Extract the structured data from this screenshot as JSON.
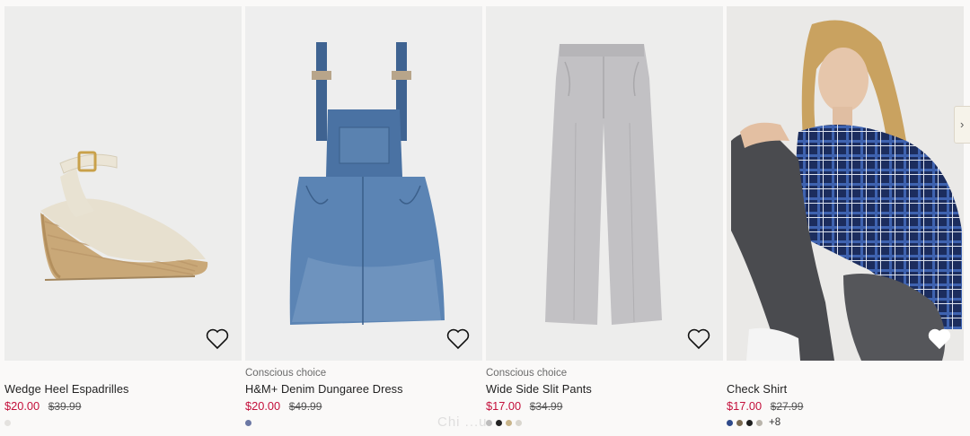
{
  "products": [
    {
      "label": "",
      "title": "Wedge Heel Espadrilles",
      "sale_price": "$20.00",
      "old_price": "$39.99",
      "swatches": [
        "#e4e2df"
      ],
      "more": ""
    },
    {
      "label": "Conscious choice",
      "title": "H&M+ Denim Dungaree Dress",
      "sale_price": "$20.00",
      "old_price": "$49.99",
      "swatches": [
        "#6b78a4"
      ],
      "more": ""
    },
    {
      "label": "Conscious choice",
      "title": "Wide Side Slit Pants",
      "sale_price": "$17.00",
      "old_price": "$34.99",
      "swatches": [
        "#bdbcbc",
        "#222222",
        "#c8b48a",
        "#d9d6cf"
      ],
      "more": ""
    },
    {
      "label": "",
      "title": "Check Shirt",
      "sale_price": "$17.00",
      "old_price": "$27.99",
      "swatches": [
        "#2f4a8a",
        "#7a6a52",
        "#1e1e1e",
        "#b9b4ab"
      ],
      "more": "+8"
    }
  ],
  "watermark": "Chi ...u",
  "colors": {
    "sale": "#c4113c",
    "background": "#faf9f8"
  }
}
